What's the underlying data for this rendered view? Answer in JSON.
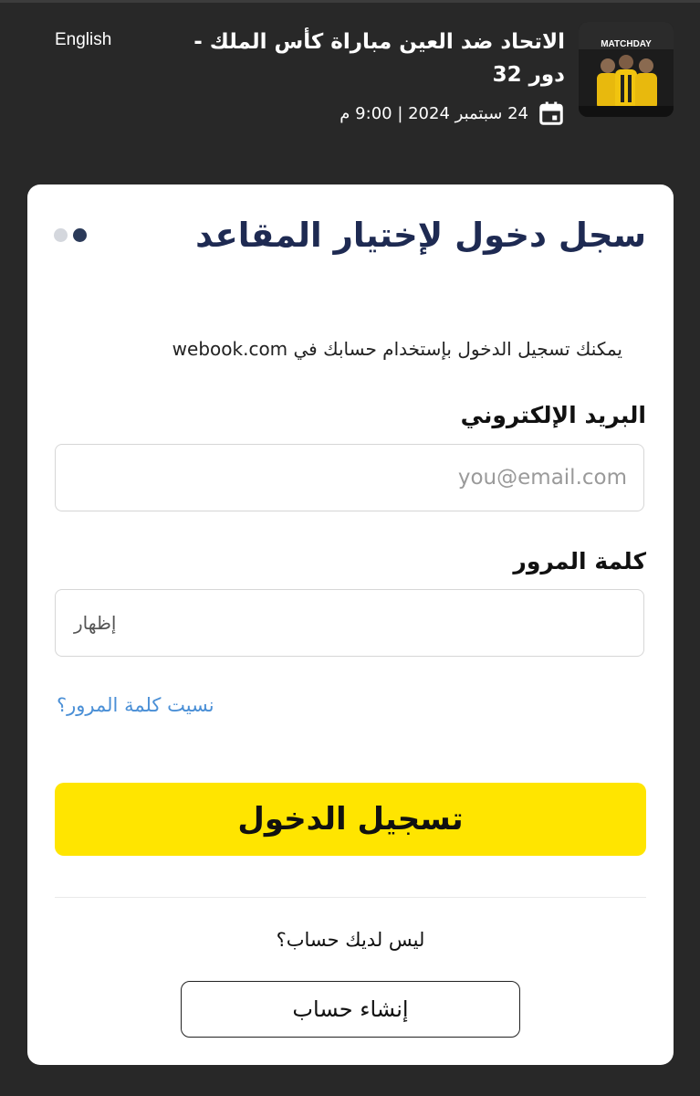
{
  "header": {
    "event_title": "الاتحاد ضد العين مباراة كأس الملك - دور 32",
    "event_date": "24 سبتمبر 2024 | 9:00 م",
    "language_switch": "English",
    "thumbnail": {
      "badge_text": "MATCHDAY"
    }
  },
  "login": {
    "title": "سجل دخول لإختيار المقاعد",
    "subtitle": "يمكنك تسجيل الدخول بإستخدام حسابك في webook.com",
    "email_label": "البريد الإلكتروني",
    "email_placeholder": "you@email.com",
    "email_value": "",
    "password_label": "كلمة المرور",
    "password_value": "",
    "show_password": "إظهار",
    "forgot_password": "نسيت كلمة المرور؟",
    "submit": "تسجيل الدخول",
    "no_account": "ليس لديك حساب؟",
    "create_account": "إنشاء حساب"
  },
  "steps": {
    "total": 2,
    "current": 2
  },
  "colors": {
    "background": "#282828",
    "primary_button": "#ffe500",
    "title": "#1e2a52",
    "link": "#4a8fd6",
    "step_active": "#2b3a59",
    "step_inactive": "#d4d7dd"
  },
  "icons": {
    "date": "calendar-icon"
  }
}
